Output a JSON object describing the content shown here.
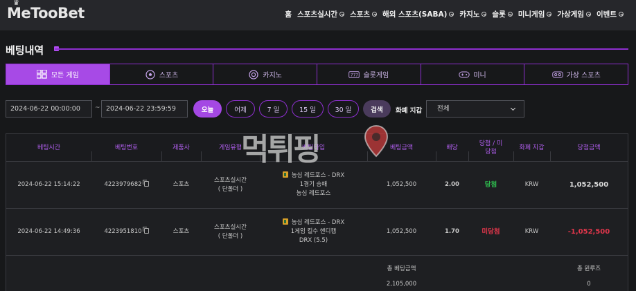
{
  "header": {
    "logo": "MeTooBet",
    "nav": [
      {
        "label": "홈",
        "has_chevron": false
      },
      {
        "label": "스포츠실시간",
        "has_chevron": true
      },
      {
        "label": "스포츠",
        "has_chevron": true
      },
      {
        "label": "해외 스포츠(SABA)",
        "has_chevron": true
      },
      {
        "label": "카지노",
        "has_chevron": true
      },
      {
        "label": "슬롯",
        "has_chevron": true
      },
      {
        "label": "미니게임",
        "has_chevron": true
      },
      {
        "label": "가상게임",
        "has_chevron": true
      },
      {
        "label": "이벤트",
        "has_chevron": true
      }
    ]
  },
  "page": {
    "title": "베팅내역"
  },
  "tabs": [
    {
      "label": "모든 게임",
      "icon": "grid-icon",
      "active": true
    },
    {
      "label": "스포츠",
      "icon": "soccer-ball-icon",
      "active": false
    },
    {
      "label": "카지노",
      "icon": "chip-icon",
      "active": false
    },
    {
      "label": "슬롯게임",
      "icon": "slot-machine-icon",
      "active": false
    },
    {
      "label": "미니",
      "icon": "gamepad-icon",
      "active": false
    },
    {
      "label": "가상 스포츠",
      "icon": "vr-headset-icon",
      "active": false
    }
  ],
  "filters": {
    "start_date": "2024-06-22 00:00:00",
    "separator": "~",
    "end_date": "2024-06-22 23:59:59",
    "quick_ranges": [
      "오늘",
      "어제",
      "7 일",
      "15 일",
      "30 일"
    ],
    "search_label": "검색",
    "currency_label": "화폐 지갑",
    "currency_value": "전체"
  },
  "table": {
    "headers": [
      "베팅시간",
      "베팅번호",
      "제품사",
      "게임유형",
      "베팅타입",
      "베팅금액",
      "배당",
      "당첨 / 미당첨",
      "화폐 지갑",
      "당첨금액"
    ],
    "rows": [
      {
        "time": "2024-06-22 15:14:22",
        "bet_id": "4223979682",
        "provider": "스포츠",
        "game_type": [
          "스포츠실시간",
          "( 단폴더 )"
        ],
        "bet_type": [
          "농심 레드포스 - DRX",
          "1경기 승패",
          "농심 레드포스"
        ],
        "amount": "1,052,500",
        "odds": "2.00",
        "result": "당첨",
        "currency": "KRW",
        "payout": "1,052,500"
      },
      {
        "time": "2024-06-22 14:49:36",
        "bet_id": "4223951810",
        "provider": "스포츠",
        "game_type": [
          "스포츠실시간",
          "( 단폴더 )"
        ],
        "bet_type": [
          "농심 레드포스 - DRX",
          "1게임 킬수 핸디캡",
          "DRX (5.5)"
        ],
        "amount": "1,052,500",
        "odds": "1.70",
        "result": "미당첨",
        "currency": "KRW",
        "payout": "-1,052,500"
      }
    ],
    "totals": {
      "bet_label": "총 베팅금액",
      "bet_value": "2,105,000",
      "win_label": "총 윈루즈",
      "win_value": "0"
    }
  },
  "watermark": {
    "text": "먹튀핑"
  },
  "colors": {
    "accent": "#a448e4",
    "win": "#2fbf4f",
    "lose": "#e0364b",
    "header_text": "#b25ff0"
  }
}
